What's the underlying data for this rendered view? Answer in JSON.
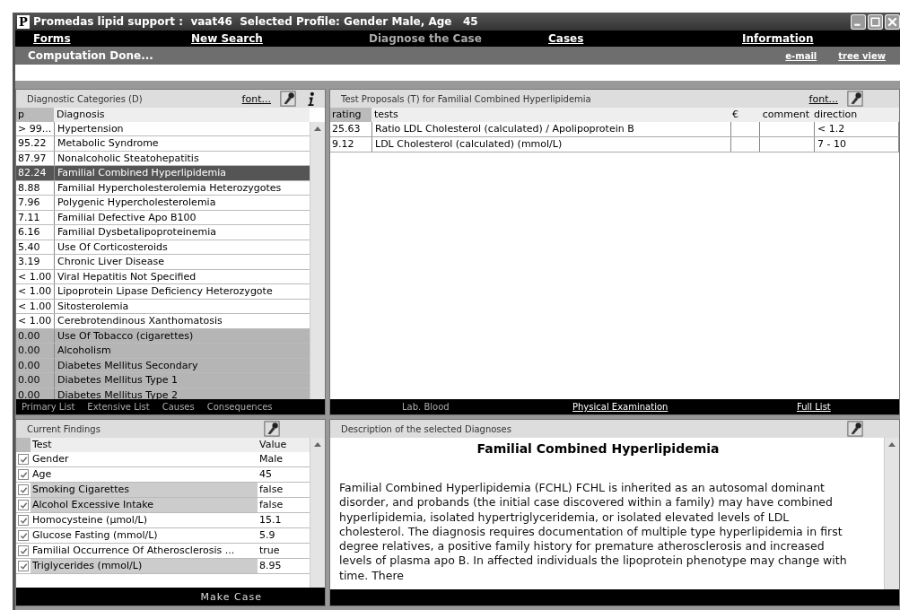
{
  "window": {
    "app_letter": "P",
    "title": "Promedas lipid support :  vaat46  Selected Profile: Gender Male, Age   45"
  },
  "nav": [
    {
      "label": "Forms",
      "selected": false
    },
    {
      "label": "New Search",
      "selected": false
    },
    {
      "label": "Diagnose the Case",
      "selected": true
    },
    {
      "label": "Cases",
      "selected": false
    },
    {
      "label": "Information",
      "selected": false
    }
  ],
  "status_bar": {
    "message": "Computation Done...",
    "links": [
      "e-mail",
      "tree view"
    ]
  },
  "diagnostic_categories": {
    "title": "Diagnostic Categories (D)",
    "font_link": "font...",
    "columns": [
      "p",
      "Diagnosis"
    ],
    "rows": [
      {
        "p": "> 99...",
        "diagnosis": "Hypertension",
        "selected": false,
        "dimmed": false
      },
      {
        "p": "95.22",
        "diagnosis": "Metabolic Syndrome",
        "selected": false,
        "dimmed": false
      },
      {
        "p": "87.97",
        "diagnosis": "Nonalcoholic Steatohepatitis",
        "selected": false,
        "dimmed": false
      },
      {
        "p": "82.24",
        "diagnosis": "Familial Combined Hyperlipidemia",
        "selected": true,
        "dimmed": false
      },
      {
        "p": "8.88",
        "diagnosis": "Familial Hypercholesterolemia Heterozygotes",
        "selected": false,
        "dimmed": false
      },
      {
        "p": "7.96",
        "diagnosis": "Polygenic Hypercholesterolemia",
        "selected": false,
        "dimmed": false
      },
      {
        "p": "7.11",
        "diagnosis": "Familial Defective Apo B100",
        "selected": false,
        "dimmed": false
      },
      {
        "p": "6.16",
        "diagnosis": "Familial Dysbetalipoproteinemia",
        "selected": false,
        "dimmed": false
      },
      {
        "p": "5.40",
        "diagnosis": "Use Of Corticosteroids",
        "selected": false,
        "dimmed": false
      },
      {
        "p": "3.19",
        "diagnosis": "Chronic Liver Disease",
        "selected": false,
        "dimmed": false
      },
      {
        "p": "< 1.00",
        "diagnosis": "Viral Hepatitis Not Specified",
        "selected": false,
        "dimmed": false
      },
      {
        "p": "< 1.00",
        "diagnosis": "Lipoprotein Lipase Deficiency Heterozygote",
        "selected": false,
        "dimmed": false
      },
      {
        "p": "< 1.00",
        "diagnosis": "Sitosterolemia",
        "selected": false,
        "dimmed": false
      },
      {
        "p": "< 1.00",
        "diagnosis": "Cerebrotendinous Xanthomatosis",
        "selected": false,
        "dimmed": false
      },
      {
        "p": "0.00",
        "diagnosis": "Use Of Tobacco (cigarettes)",
        "selected": false,
        "dimmed": true
      },
      {
        "p": "0.00",
        "diagnosis": "Alcoholism",
        "selected": false,
        "dimmed": true
      },
      {
        "p": "0.00",
        "diagnosis": "Diabetes Mellitus Secondary",
        "selected": false,
        "dimmed": true
      },
      {
        "p": "0.00",
        "diagnosis": "Diabetes Mellitus Type 1",
        "selected": false,
        "dimmed": true
      },
      {
        "p": "0.00",
        "diagnosis": "Diabetes Mellitus Type 2",
        "selected": false,
        "dimmed": true
      }
    ],
    "tabs": [
      "Primary List",
      "Extensive List",
      "Causes",
      "Consequences"
    ]
  },
  "test_proposals": {
    "title": "Test Proposals (T) for Familial Combined Hyperlipidemia",
    "font_link": "font...",
    "columns": [
      "rating",
      "tests",
      "€",
      "comment",
      "direction"
    ],
    "rows": [
      {
        "rating": "25.63",
        "tests": "Ratio LDL Cholesterol (calculated) / Apolipoprotein B",
        "direction": "< 1.2"
      },
      {
        "rating": "9.12",
        "tests": "LDL Cholesterol (calculated) (mmol/L)",
        "direction": "7 - 10"
      }
    ],
    "tabs": [
      {
        "label": "Lab. Blood",
        "selected": true
      },
      {
        "label": "Physical Examination",
        "selected": false
      },
      {
        "label": "Full List",
        "selected": false
      }
    ]
  },
  "current_findings": {
    "title": "Current Findings",
    "columns": [
      "Test",
      "Value"
    ],
    "rows": [
      {
        "test": "Gender",
        "value": "Male",
        "checked": true,
        "shaded": false
      },
      {
        "test": "Age",
        "value": "45",
        "checked": true,
        "shaded": false
      },
      {
        "test": "Smoking Cigarettes",
        "value": "false",
        "checked": true,
        "shaded": true
      },
      {
        "test": "Alcohol Excessive Intake",
        "value": "false",
        "checked": true,
        "shaded": true
      },
      {
        "test": "Homocysteine (µmol/L)",
        "value": "15.1",
        "checked": true,
        "shaded": false
      },
      {
        "test": "Glucose Fasting (mmol/L)",
        "value": "5.9",
        "checked": true,
        "shaded": false
      },
      {
        "test": "Familial Occurrence Of Atherosclerosis ...",
        "value": "true",
        "checked": true,
        "shaded": false
      },
      {
        "test": "Triglycerides (mmol/L)",
        "value": "8.95",
        "checked": true,
        "shaded": true
      }
    ],
    "button": "Make Case"
  },
  "description": {
    "title": "Description of the selected Diagnoses",
    "heading": "Familial Combined Hyperlipidemia",
    "text": "Familial Combined Hyperlipidemia (FCHL) FCHL is inherited as an autosomal dominant disorder, and probands (the initial case discovered within a family) may have combined hyperlipidemia, isolated hypertriglyceridemia, or isolated elevated levels of LDL cholesterol. The diagnosis requires documentation of multiple type hyperlipidemia in first degree relatives, a positive family history for premature atherosclerosis and increased levels of plasma apo B. In affected individuals the lipoprotein phenotype may change with time. There"
  }
}
